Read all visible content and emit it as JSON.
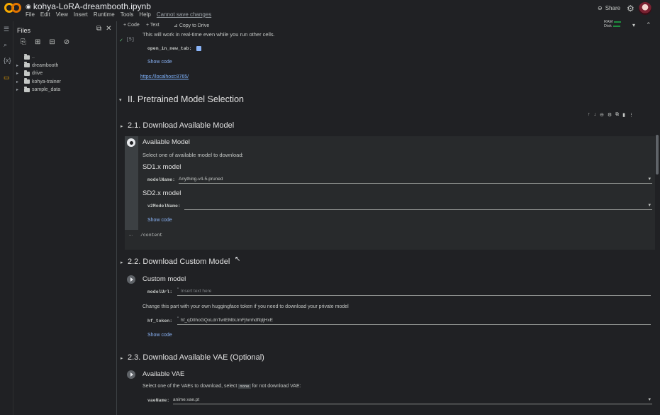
{
  "header": {
    "filename": "kohya-LoRA-dreambooth.ipynb",
    "menus": [
      "File",
      "Edit",
      "View",
      "Insert",
      "Runtime",
      "Tools",
      "Help"
    ],
    "warning": "Cannot save changes",
    "share": "Share"
  },
  "files": {
    "title": "Files",
    "tree": [
      "..",
      "dreambooth",
      "drive",
      "kohya-trainer",
      "sample_data"
    ]
  },
  "toolbar": {
    "code": "+ Code",
    "text": "+ Text",
    "copy": "Copy to Drive",
    "ram": "RAM",
    "disk": "Disk"
  },
  "cell_prev": {
    "exec_count": "[5]",
    "note": "This will work in real-time even while you run other cells.",
    "field_label": "open_in_new_tab:",
    "show_code": "Show code",
    "link": "https://localhost:8765/"
  },
  "section2": {
    "title": "II. Pretrained Model Selection"
  },
  "s21": {
    "title": "2.1. Download Available Model",
    "heading": "Available Model",
    "desc": "Select one of available model to download:",
    "sd1": "SD1.x model",
    "model_label": "modelName:",
    "model_value": "Anything-v4-5-pruned",
    "sd2": "SD2.x model",
    "v2_label": "v2ModelName:",
    "v2_value": "",
    "show_code": "Show code",
    "output": "/content",
    "dots": "..."
  },
  "s22": {
    "title": "2.2. Download Custom Model",
    "heading": "Custom model",
    "url_label": "modelUrl:",
    "url_placeholder": "Insert text here",
    "desc": "Change this part with your own huggingface token if you need to download your private model",
    "token_label": "hf_token:",
    "token_value": "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",
    "show_code": "Show code"
  },
  "s23": {
    "title": "2.3. Download Available VAE (Optional)",
    "heading": "Available VAE",
    "desc_pre": "Select one of the VAEs to download, select",
    "desc_tag": "none",
    "desc_post": "for not download VAE:",
    "vae_label": "vaeName:",
    "vae_value": "anime.vae.pt"
  },
  "colors": {
    "accent": "#f9ab00",
    "link": "#8ab4f8",
    "bg": "#1f1f1f"
  }
}
